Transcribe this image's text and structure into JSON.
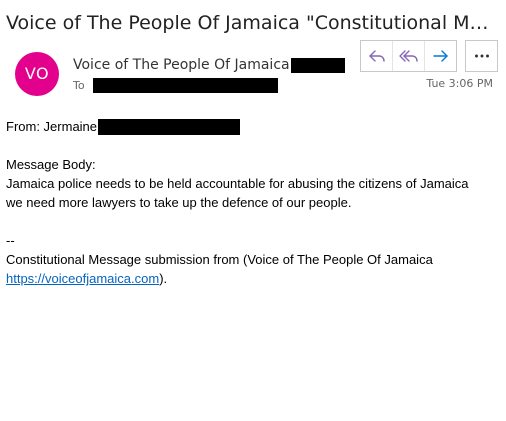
{
  "header": {
    "subject": "Voice of The People Of Jamaica \"Constitutional Messag...",
    "avatar_initials": "VO",
    "avatar_color": "#e3008c",
    "sender_name": "Voice of The People Of Jamaica",
    "to_label": "To",
    "time": "Tue 3:06 PM"
  },
  "actions": {
    "reply": "reply-icon",
    "reply_all": "reply-all-icon",
    "forward": "forward-icon",
    "more": "more-icon",
    "accent_color": "#8764b8",
    "forward_color": "#0078d4"
  },
  "body": {
    "from_label": "From: Jermaine",
    "message_body_label": "Message Body:",
    "line1": "Jamaica police needs to be held accountable for abusing the citizens of Jamaica",
    "line2": "we need more lawyers to take up the defence of our people.",
    "separator": "--",
    "footer_line1": "Constitutional Message submission from (Voice of The People Of Jamaica",
    "footer_link": "https://voiceofjamaica.com",
    "footer_end": ")."
  }
}
